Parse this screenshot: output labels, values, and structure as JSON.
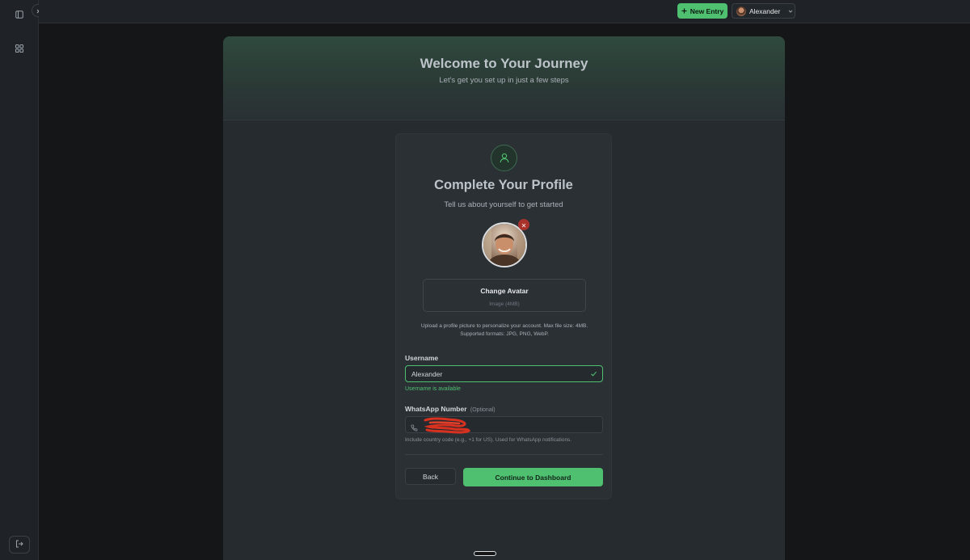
{
  "topbar": {
    "new_entry_label": "New Entry",
    "user_name": "Alexander"
  },
  "hero": {
    "title": "Welcome to Your Journey",
    "subtitle": "Let's get you set up in just a few steps"
  },
  "profile": {
    "title": "Complete Your Profile",
    "subtitle": "Tell us about yourself to get started",
    "change_avatar_label": "Change Avatar",
    "change_avatar_hint": "Image (4MB)",
    "upload_help": "Upload a profile picture to personalize your account. Max file size: 4MB. Supported formats: JPG, PNG, WebP.",
    "username_label": "Username",
    "username_value": "Alexander",
    "username_status": "Username is available",
    "whatsapp_label": "WhatsApp Number",
    "whatsapp_optional": "(Optional)",
    "whatsapp_help": "Include country code (e.g., +1 for US). Used for WhatsApp notifications.",
    "back_label": "Back",
    "continue_label": "Continue to Dashboard"
  },
  "colors": {
    "accent": "#4ec070",
    "danger": "#a8322b",
    "background": "#141618",
    "card": "#262b30"
  },
  "icons": {
    "sidebar_toggle": "sidebar-panel-icon",
    "grid": "grid-icon",
    "logout": "logout-icon",
    "user": "user-icon",
    "check": "check-icon",
    "phone": "phone-icon"
  }
}
